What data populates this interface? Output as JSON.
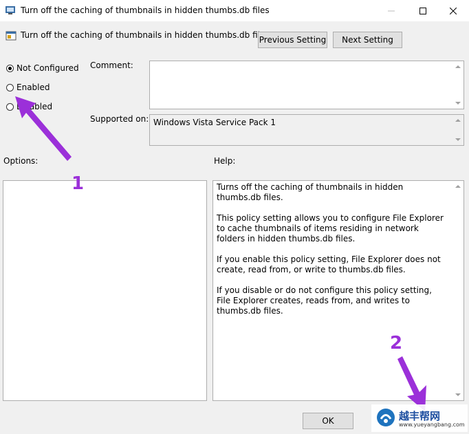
{
  "window": {
    "title": "Turn off the caching of thumbnails in hidden thumbs.db files",
    "icons": {
      "app": "group-policy-app-icon",
      "minimize": "minimize-icon",
      "maximize": "maximize-icon",
      "close": "close-icon"
    }
  },
  "header": {
    "policy_name": "Turn off the caching of thumbnails in hidden thumbs.db files",
    "policy_icon": "policy-setting-icon",
    "previous_label": "Previous Setting",
    "next_label": "Next Setting"
  },
  "state": {
    "options": [
      {
        "label": "Not Configured",
        "selected": true
      },
      {
        "label": "Enabled",
        "selected": false
      },
      {
        "label": "Disabled",
        "selected": false
      }
    ]
  },
  "comment": {
    "label": "Comment:",
    "value": ""
  },
  "supported": {
    "label": "Supported on:",
    "value": "Windows Vista Service Pack 1"
  },
  "options_label": "Options:",
  "help": {
    "label": "Help:",
    "paragraphs": [
      "Turns off the caching of thumbnails in hidden thumbs.db files.",
      "This policy setting allows you to configure File Explorer to cache thumbnails of items residing in network folders in hidden thumbs.db files.",
      "If you enable this policy setting, File Explorer does not create, read from, or write to thumbs.db files.",
      "If you disable or do not configure this policy setting, File Explorer creates, reads from, and writes to thumbs.db files."
    ]
  },
  "footer": {
    "ok_label": "OK"
  },
  "annotations": {
    "first": "1",
    "second": "2",
    "color": "#9b30d9"
  },
  "watermark": {
    "text": "www.yueyangbang.com",
    "brand": "越丰帮网"
  }
}
